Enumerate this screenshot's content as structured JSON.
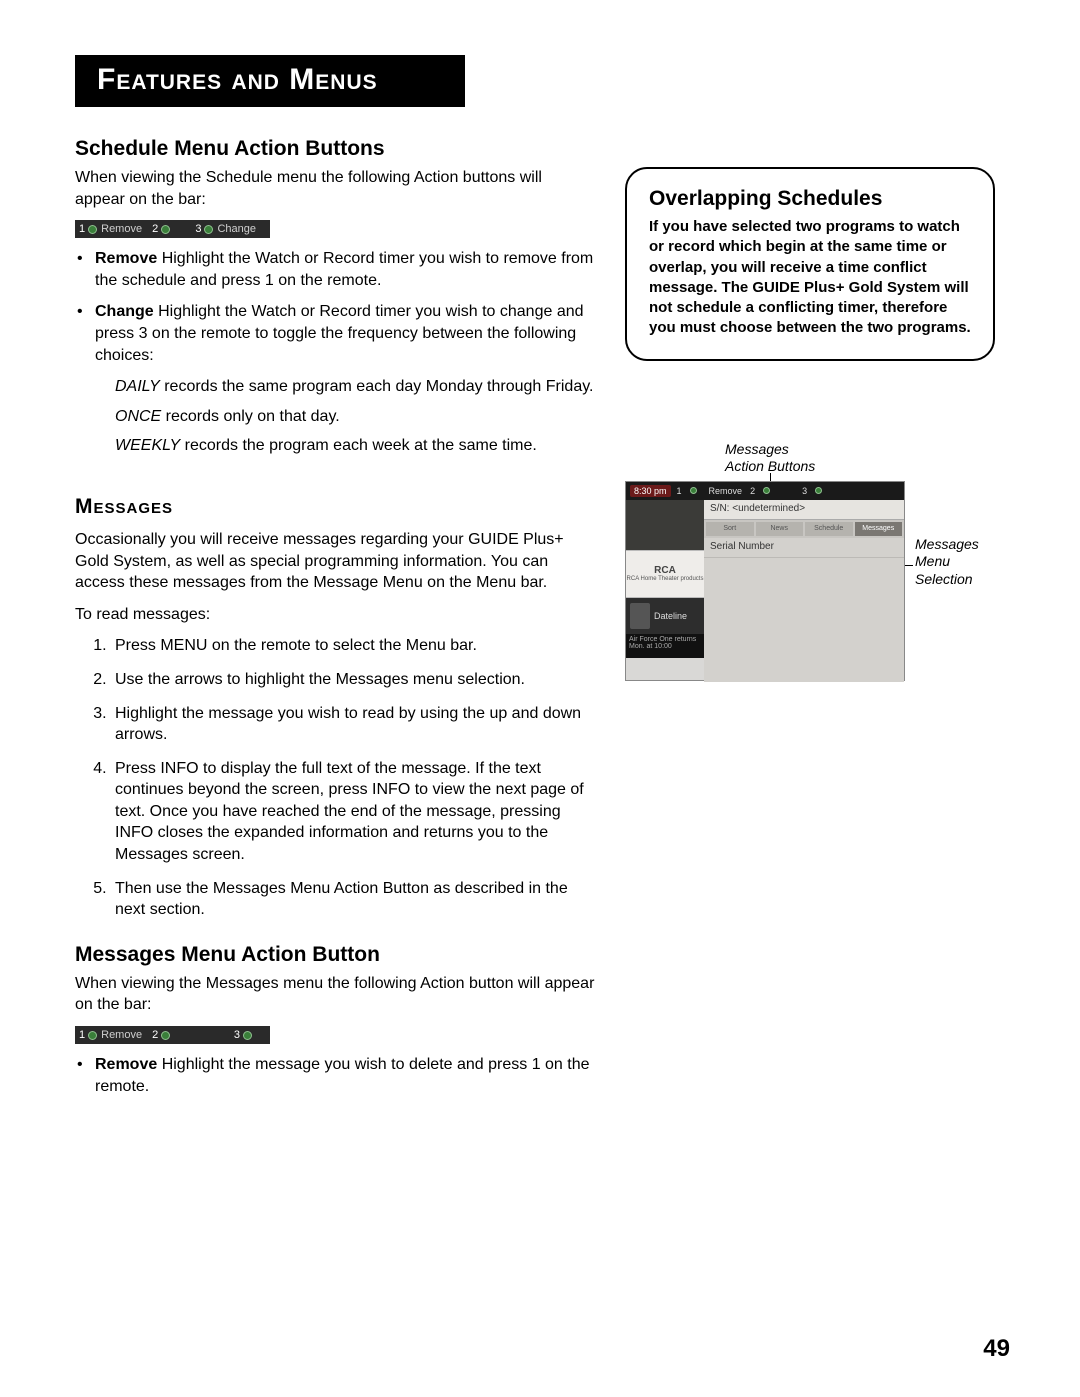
{
  "chapter_title": "Features and Menus",
  "section1": {
    "heading": "Schedule Menu Action Buttons",
    "intro": "When viewing the Schedule menu the following Action buttons will appear on the bar:",
    "actionbar": {
      "btn1": "Remove",
      "btn3": "Change"
    },
    "bullets": {
      "remove_label": "Remove",
      "remove_text": "   Highlight the Watch or Record timer you wish to remove from the schedule and press 1 on the remote.",
      "change_label": "Change",
      "change_text": "   Highlight the Watch or Record timer you wish to change and press 3 on the remote to toggle the frequency between the following choices:"
    },
    "freq": {
      "daily_label": "DAILY",
      "daily_text": "   records the same program each day Monday through Friday.",
      "once_label": "ONCE",
      "once_text": "   records only on that day.",
      "weekly_label": "WEEKLY",
      "weekly_text": "   records the program each week at the same time."
    }
  },
  "section_messages": {
    "heading": "Messages",
    "intro": "Occasionally you will receive messages regarding your GUIDE Plus+ Gold System, as well as special programming information.  You can access these messages from the Message Menu on the Menu bar.",
    "to_read": "To read messages:",
    "steps": [
      "Press MENU on the remote to select the Menu bar.",
      "Use the arrows to highlight the Messages menu selection.",
      "Highlight the message you wish to read by using the up and down arrows.",
      "Press INFO to display the full text of the message. If the text continues beyond the screen, press INFO to view the next page of text. Once you have reached the end of the message, pressing INFO closes the expanded information and returns you to the Messages screen.",
      "Then use the Messages Menu Action Button as described in the next section."
    ]
  },
  "section_msg_action": {
    "heading": "Messages Menu Action Button",
    "intro": "When viewing the Messages menu the following Action button will appear on the bar:",
    "actionbar": {
      "btn1": "Remove"
    },
    "bullet_label": "Remove",
    "bullet_text": "   Highlight the message you wish to delete and press 1 on the remote."
  },
  "overlap": {
    "heading": "Overlapping Schedules",
    "body": "If you have selected two programs to watch or record which begin at the same time or overlap, you will receive a time conflict message. The GUIDE Plus+ Gold System will not schedule a conflicting timer, therefore you must choose between the two programs."
  },
  "figure": {
    "label1": "Messages\nAction Buttons",
    "label2": "Messages\nMenu\nSelection",
    "screenshot": {
      "time": "8:30 pm",
      "act_remove": "Remove",
      "sn_line": "S/N: <undetermined>",
      "tabs": [
        "Sort",
        "News",
        "Schedule",
        "Messages"
      ],
      "row1": "Serial Number",
      "rca": "RCA",
      "rca_sub": "RCA Home Theater products",
      "dateline": "Dateline",
      "foot1": "Air Force One returns",
      "foot2": "Mon. at 10:00"
    }
  },
  "page_number": "49"
}
